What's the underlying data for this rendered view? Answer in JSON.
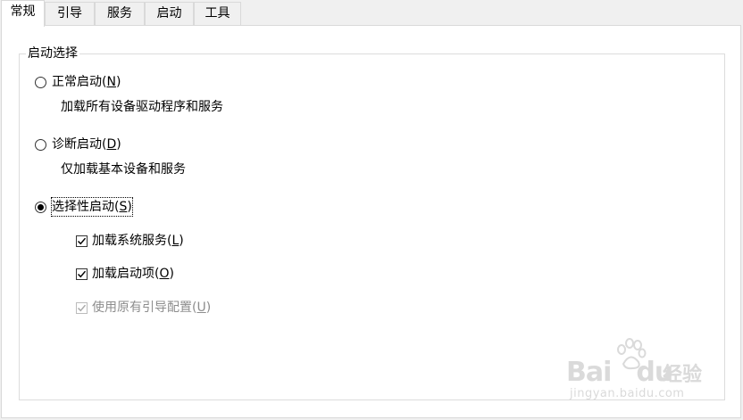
{
  "tabs": [
    {
      "label": "常规",
      "active": true
    },
    {
      "label": "引导",
      "active": false
    },
    {
      "label": "服务",
      "active": false
    },
    {
      "label": "启动",
      "active": false
    },
    {
      "label": "工具",
      "active": false
    }
  ],
  "group": {
    "title": "启动选择"
  },
  "options": {
    "normal": {
      "label": "正常启动(",
      "hotkey": "N",
      "label_end": ")",
      "description": "加载所有设备驱动程序和服务",
      "selected": false
    },
    "diagnostic": {
      "label": "诊断启动(",
      "hotkey": "D",
      "label_end": ")",
      "description": "仅加载基本设备和服务",
      "selected": false
    },
    "selective": {
      "label": "选择性启动(",
      "hotkey": "S",
      "label_end": ")",
      "selected": true
    }
  },
  "checkboxes": {
    "load_system_services": {
      "label": "加载系统服务(",
      "hotkey": "L",
      "label_end": ")",
      "checked": true,
      "enabled": true
    },
    "load_startup_items": {
      "label": "加载启动项(",
      "hotkey": "O",
      "label_end": ")",
      "checked": true,
      "enabled": true
    },
    "use_original_boot": {
      "label": "使用原有引导配置(",
      "hotkey": "U",
      "label_end": ")",
      "checked": true,
      "enabled": false
    }
  },
  "watermark": {
    "brand": "Bai",
    "brand_tail": "du",
    "cn": "经验",
    "url": "jingyan.baidu.com"
  },
  "colors": {
    "panel_bg": "#ffffff",
    "window_bg": "#f0f0f0",
    "border": "#d9d9d9",
    "disabled_text": "#8d8d8d",
    "watermark": "#dadada"
  }
}
